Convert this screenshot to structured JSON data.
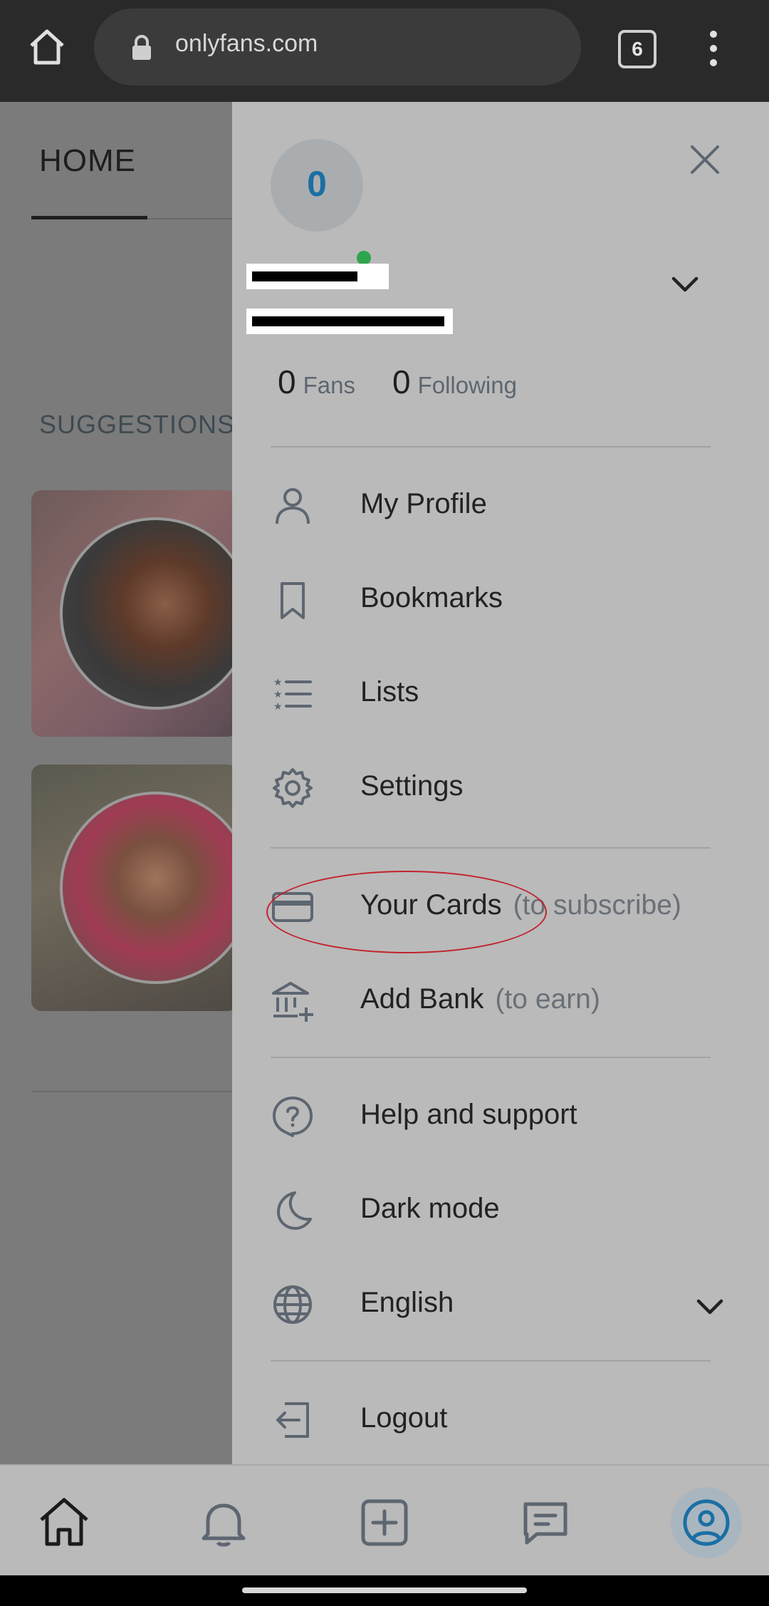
{
  "browser": {
    "url": "onlyfans.com",
    "tab_count": "6"
  },
  "background_page": {
    "tab_label": "HOME",
    "section_title": "SUGGESTIONS"
  },
  "drawer": {
    "avatar_initial": "0",
    "stats": {
      "fans_count": "0",
      "fans_label": "Fans",
      "following_count": "0",
      "following_label": "Following"
    },
    "menu": [
      {
        "label": "My Profile",
        "icon": "user-icon"
      },
      {
        "label": "Bookmarks",
        "icon": "bookmark-icon"
      },
      {
        "label": "Lists",
        "icon": "list-icon"
      },
      {
        "label": "Settings",
        "icon": "gear-icon"
      },
      {
        "label": "Your Cards",
        "hint": "(to subscribe)",
        "icon": "credit-card-icon"
      },
      {
        "label": "Add Bank",
        "hint": "(to earn)",
        "icon": "bank-icon"
      },
      {
        "label": "Help and support",
        "icon": "help-icon"
      },
      {
        "label": "Dark mode",
        "icon": "moon-icon"
      },
      {
        "label": "English",
        "icon": "globe-icon"
      },
      {
        "label": "Logout",
        "icon": "logout-icon"
      }
    ]
  },
  "colors": {
    "accent": "#1a6fa3",
    "online": "#2fa44f",
    "annotation": "#c2232d"
  }
}
